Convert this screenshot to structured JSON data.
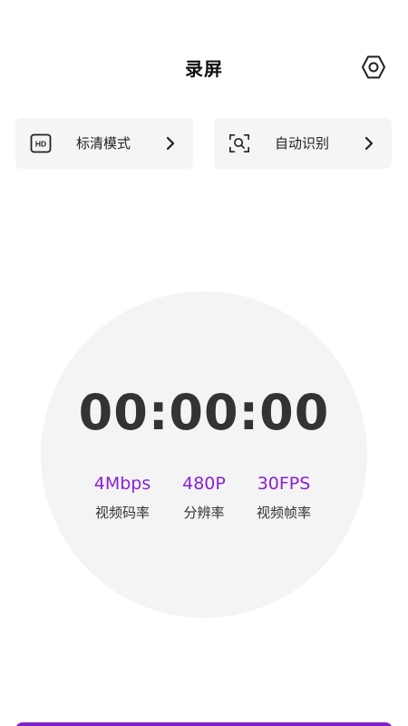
{
  "header": {
    "title": "录屏",
    "settings_icon": "hexagon-settings-icon"
  },
  "modes": [
    {
      "label": "标清模式",
      "icon": "hd-badge-icon"
    },
    {
      "label": "自动识别",
      "icon": "scan-search-icon"
    }
  ],
  "dial": {
    "timer": "00:00:00",
    "stats": [
      {
        "value": "4Mbps",
        "label": "视频码率"
      },
      {
        "value": "480P",
        "label": "分辨率"
      },
      {
        "value": "30FPS",
        "label": "视频帧率"
      }
    ]
  },
  "colors": {
    "accent": "#8a1fd6",
    "record_button": "#7b22c8",
    "card_bg": "#f5f5f5",
    "dial_bg": "#f4f4f4"
  }
}
